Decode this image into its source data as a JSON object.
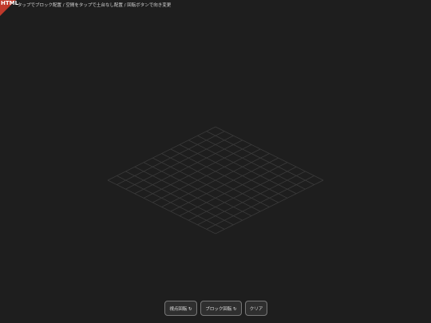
{
  "corner": {
    "label": "HTML",
    "color": "#c0392b"
  },
  "hint": "タップでブロック配置 / 空間をタップで土台なし配置 / 回転ボタンで向き変更",
  "grid": {
    "size": 12,
    "line_color": "#3a3a3a",
    "background": "#1e1e1e"
  },
  "toolbar": {
    "rotate_view_label": "視点回転 ↻",
    "rotate_block_label": "ブロック回転 ↻",
    "clear_label": "クリア"
  }
}
